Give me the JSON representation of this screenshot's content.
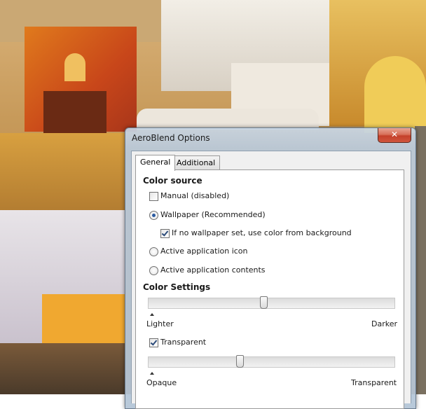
{
  "dialog": {
    "title": "AeroBlend Options",
    "close_glyph": "✕"
  },
  "tabs": [
    {
      "label": "General",
      "selected": true
    },
    {
      "label": "Additional",
      "selected": false
    }
  ],
  "color_source": {
    "heading": "Color source",
    "manual": {
      "label": "Manual (disabled)",
      "checked": false
    },
    "wallpaper": {
      "label": "Wallpaper (Recommended)",
      "selected": true
    },
    "fallback": {
      "label": "If no wallpaper set, use color from background",
      "checked": true
    },
    "app_icon": {
      "label": "Active application icon",
      "selected": false
    },
    "app_contents": {
      "label": "Active application contents",
      "selected": false
    }
  },
  "color_settings": {
    "heading": "Color Settings",
    "brightness": {
      "min_label": "Lighter",
      "max_label": "Darker",
      "value": 0.47
    },
    "transparent": {
      "label": "Transparent",
      "checked": true
    },
    "opacity": {
      "min_label": "Opaque",
      "max_label": "Transparent",
      "value": 0.37
    }
  }
}
